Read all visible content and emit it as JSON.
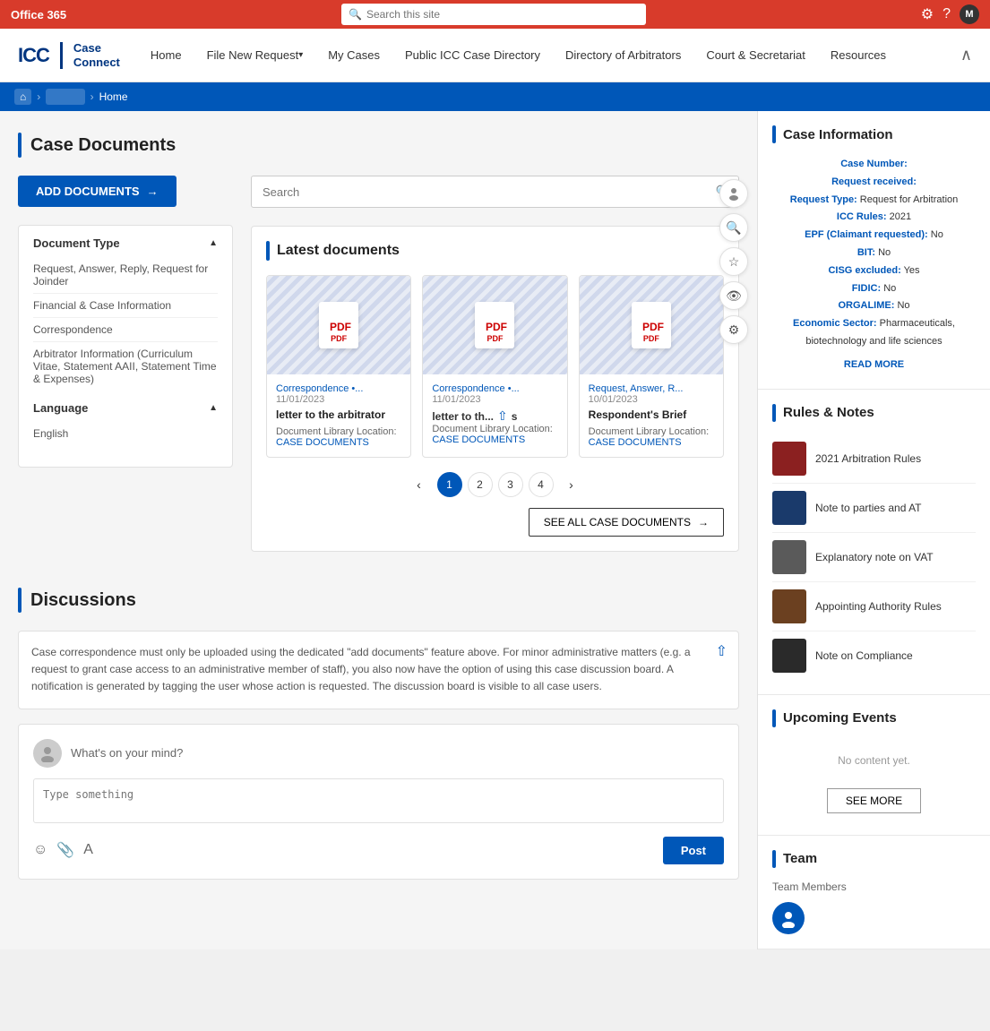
{
  "topbar": {
    "title": "Office 365",
    "search_placeholder": "Search this site",
    "avatar_initial": "M"
  },
  "navbar": {
    "logo_text": "ICC",
    "logo_subtitle1": "Case",
    "logo_subtitle2": "Connect",
    "links": [
      {
        "label": "Home",
        "has_arrow": false
      },
      {
        "label": "File New Request",
        "has_arrow": true
      },
      {
        "label": "My Cases",
        "has_arrow": false
      },
      {
        "label": "Public ICC Case Directory",
        "has_arrow": false
      },
      {
        "label": "Directory of Arbitrators",
        "has_arrow": false
      },
      {
        "label": "Court & Secretariat",
        "has_arrow": false
      },
      {
        "label": "Resources",
        "has_arrow": false
      }
    ]
  },
  "breadcrumb": {
    "home_icon": "⌂",
    "items": [
      "Home"
    ]
  },
  "case_documents": {
    "title": "Case Documents",
    "add_button": "ADD DOCUMENTS",
    "search_placeholder": "Search",
    "filter": {
      "document_type_label": "Document Type",
      "document_types": [
        "Request, Answer, Reply, Request for Joinder",
        "Financial & Case Information",
        "Correspondence",
        "Arbitrator Information (Curriculum Vitae, Statement AAII, Statement Time & Expenses)"
      ],
      "language_label": "Language",
      "languages": [
        "English"
      ]
    },
    "latest_label": "Latest documents",
    "documents": [
      {
        "tag": "Correspondence •...",
        "date": "11/01/2023",
        "title": "letter to the arbitrator",
        "location_label": "Document Library Location:",
        "location_link": "CASE DOCUMENTS"
      },
      {
        "tag": "Correspondence •...",
        "date": "11/01/2023",
        "title": "letter to th...",
        "location_label": "Document Library Location:",
        "location_link": "CASE DOCUMENTS"
      },
      {
        "tag": "Request, Answer, R...",
        "date": "10/01/2023",
        "title": "Respondent's Brief",
        "location_label": "Document Library Location:",
        "location_link": "CASE DOCUMENTS"
      }
    ],
    "pagination": [
      "1",
      "2",
      "3",
      "4"
    ],
    "see_all_button": "SEE ALL CASE DOCUMENTS"
  },
  "discussions": {
    "title": "Discussions",
    "description": "Case correspondence must only be uploaded using the dedicated \"add documents\" feature above. For minor administrative matters (e.g. a request to grant case access to an administrative member of staff), you also now have the option of using this case discussion board. A notification is generated by tagging the user whose action is requested. The discussion board is visible to all case users.",
    "placeholder": "What's on your mind?",
    "textarea_placeholder": "Type something",
    "post_button": "Post"
  },
  "case_information": {
    "title": "Case Information",
    "fields": [
      {
        "label": "Case Number:",
        "value": ""
      },
      {
        "label": "Request received:",
        "value": ""
      },
      {
        "label": "Request Type:",
        "value": "Request for Arbitration"
      },
      {
        "label": "ICC Rules:",
        "value": "2021"
      },
      {
        "label": "EPF (Claimant requested):",
        "value": "No"
      },
      {
        "label": "BIT:",
        "value": "No"
      },
      {
        "label": "CISG excluded:",
        "value": "Yes"
      },
      {
        "label": "FIDIC:",
        "value": "No"
      },
      {
        "label": "ORGALIME:",
        "value": "No"
      },
      {
        "label": "Economic Sector:",
        "value": "Pharmaceuticals, biotechnology and life sciences"
      }
    ],
    "read_more": "READ MORE"
  },
  "rules_notes": {
    "title": "Rules & Notes",
    "items": [
      {
        "title": "2021 Arbitration Rules",
        "thumb_color": "thumb-red"
      },
      {
        "title": "Note to parties and AT",
        "thumb_color": "thumb-blue"
      },
      {
        "title": "Explanatory note on VAT",
        "thumb_color": "thumb-gray"
      },
      {
        "title": "Appointing Authority Rules",
        "thumb_color": "thumb-brown"
      },
      {
        "title": "Note on Compliance",
        "thumb_color": "thumb-dark"
      }
    ]
  },
  "upcoming_events": {
    "title": "Upcoming Events",
    "no_content": "No content yet.",
    "see_more_button": "SEE MORE"
  },
  "team": {
    "title": "Team",
    "members_label": "Team Members"
  }
}
